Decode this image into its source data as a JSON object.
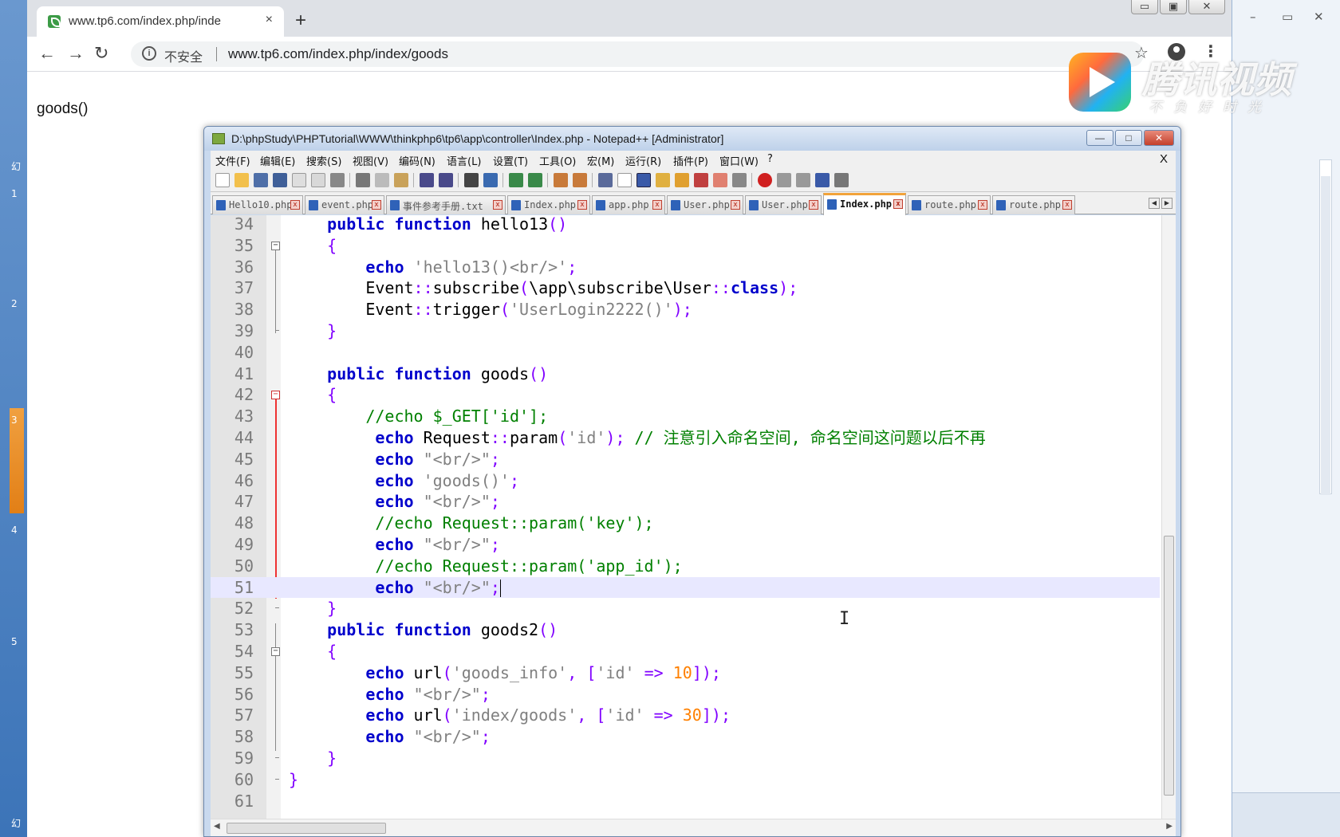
{
  "desktop": {
    "left_strip_numbers": [
      "幻",
      "1",
      "2",
      "3",
      "4",
      "5",
      "幻"
    ]
  },
  "browser": {
    "tab_title": "www.tp6.com/index.php/inde",
    "tab_close": "×",
    "new_tab": "+",
    "window_controls": {
      "minimize": "▭",
      "restore": "▣",
      "close": "✕"
    },
    "nav": {
      "back": "←",
      "forward": "→",
      "reload": "↻"
    },
    "security_label": "不安全",
    "url": "www.tp6.com/index.php/index/goods",
    "page_text": "goods()"
  },
  "watermark": {
    "brand": "腾讯视频",
    "slogan": "不负好时光"
  },
  "notepad": {
    "title": "D:\\phpStudy\\PHPTutorial\\WWW\\thinkphp6\\tp6\\app\\controller\\Index.php - Notepad++ [Administrator]",
    "window_controls": {
      "minimize": "—",
      "maximize": "□",
      "close": "✕"
    },
    "menu": [
      "文件(F)",
      "编辑(E)",
      "搜索(S)",
      "视图(V)",
      "编码(N)",
      "语言(L)",
      "设置(T)",
      "工具(O)",
      "宏(M)",
      "运行(R)",
      "插件(P)",
      "窗口(W)",
      "?"
    ],
    "menu_close": "X",
    "tabs": [
      {
        "label": "Hello10.php",
        "active": false
      },
      {
        "label": "event.php",
        "active": false
      },
      {
        "label": "事件参考手册.txt",
        "active": false
      },
      {
        "label": "Index.php",
        "active": false
      },
      {
        "label": "app.php",
        "active": false
      },
      {
        "label": "User.php",
        "active": false
      },
      {
        "label": "User.php",
        "active": false
      },
      {
        "label": "Index.php",
        "active": true
      },
      {
        "label": "route.php",
        "active": false
      },
      {
        "label": "route.php",
        "active": false
      }
    ],
    "lines": [
      {
        "n": "34",
        "html": "    <span class='kw'>public function</span> hello13<span class='op'>()</span>"
      },
      {
        "n": "35",
        "html": "    <span class='op'>{</span>"
      },
      {
        "n": "36",
        "html": "        <span class='kw'>echo</span> <span class='str'>'hello13()&lt;br/&gt;'</span><span class='op'>;</span>"
      },
      {
        "n": "37",
        "html": "        Event<span class='op'>::</span>subscribe<span class='op'>(</span>\\app\\subscribe\\User<span class='op'>::</span><span class='kw'>class</span><span class='op'>);</span>"
      },
      {
        "n": "38",
        "html": "        Event<span class='op'>::</span>trigger<span class='op'>(</span><span class='str'>'UserLogin2222()'</span><span class='op'>);</span>"
      },
      {
        "n": "39",
        "html": "    <span class='op'>}</span>"
      },
      {
        "n": "40",
        "html": ""
      },
      {
        "n": "41",
        "html": "    <span class='kw'>public function</span> goods<span class='op'>()</span>"
      },
      {
        "n": "42",
        "html": "    <span class='op'>{</span>"
      },
      {
        "n": "43",
        "html": "        <span class='cm'>//echo $_GET['id'];</span>"
      },
      {
        "n": "44",
        "html": "         <span class='kw'>echo</span> Request<span class='op'>::</span>param<span class='op'>(</span><span class='str'>'id'</span><span class='op'>);</span> <span class='cm'>// 注意引入命名空间, 命名空间这问题以后不再</span>"
      },
      {
        "n": "45",
        "html": "         <span class='kw'>echo</span> <span class='str'>\"&lt;br/&gt;\"</span><span class='op'>;</span>"
      },
      {
        "n": "46",
        "html": "         <span class='kw'>echo</span> <span class='str'>'goods()'</span><span class='op'>;</span>"
      },
      {
        "n": "47",
        "html": "         <span class='kw'>echo</span> <span class='str'>\"&lt;br/&gt;\"</span><span class='op'>;</span>"
      },
      {
        "n": "48",
        "html": "         <span class='cm'>//echo Request::param('key');</span>"
      },
      {
        "n": "49",
        "html": "         <span class='kw'>echo</span> <span class='str'>\"&lt;br/&gt;\"</span><span class='op'>;</span>"
      },
      {
        "n": "50",
        "html": "         <span class='cm'>//echo Request::param('app_id');</span>"
      },
      {
        "n": "51",
        "html": "         <span class='kw'>echo</span> <span class='str'>\"&lt;br/&gt;\"</span><span class='op'>;</span><span class='cursor-caret'></span>",
        "current": true
      },
      {
        "n": "52",
        "html": "    <span class='op'>}</span>"
      },
      {
        "n": "53",
        "html": "    <span class='kw'>public function</span> goods2<span class='op'>()</span>"
      },
      {
        "n": "54",
        "html": "    <span class='op'>{</span>"
      },
      {
        "n": "55",
        "html": "        <span class='kw'>echo</span> url<span class='op'>(</span><span class='str'>'goods_info'</span><span class='op'>,</span> <span class='op'>[</span><span class='str'>'id'</span> <span class='op'>=&gt;</span> <span class='num'>10</span><span class='op'>]);</span>"
      },
      {
        "n": "56",
        "html": "        <span class='kw'>echo</span> <span class='str'>\"&lt;br/&gt;\"</span><span class='op'>;</span>"
      },
      {
        "n": "57",
        "html": "        <span class='kw'>echo</span> url<span class='op'>(</span><span class='str'>'index/goods'</span><span class='op'>,</span> <span class='op'>[</span><span class='str'>'id'</span> <span class='op'>=&gt;</span> <span class='num'>30</span><span class='op'>]);</span>"
      },
      {
        "n": "58",
        "html": "        <span class='kw'>echo</span> <span class='str'>\"&lt;br/&gt;\"</span><span class='op'>;</span>"
      },
      {
        "n": "59",
        "html": "    <span class='op'>}</span>"
      },
      {
        "n": "60",
        "html": "<span class='op'>}</span>"
      },
      {
        "n": "61",
        "html": ""
      }
    ],
    "fold_markers": {
      "35": "box",
      "42": "box-red",
      "54": "box",
      "39": "tick",
      "52": "tick",
      "59": "tick",
      "60": "tick"
    }
  },
  "colors": {
    "keyword": "#0000cc",
    "string": "#808080",
    "comment": "#008000",
    "number": "#ff8000",
    "operator": "#8000ff",
    "current_line": "#e8e8ff"
  }
}
